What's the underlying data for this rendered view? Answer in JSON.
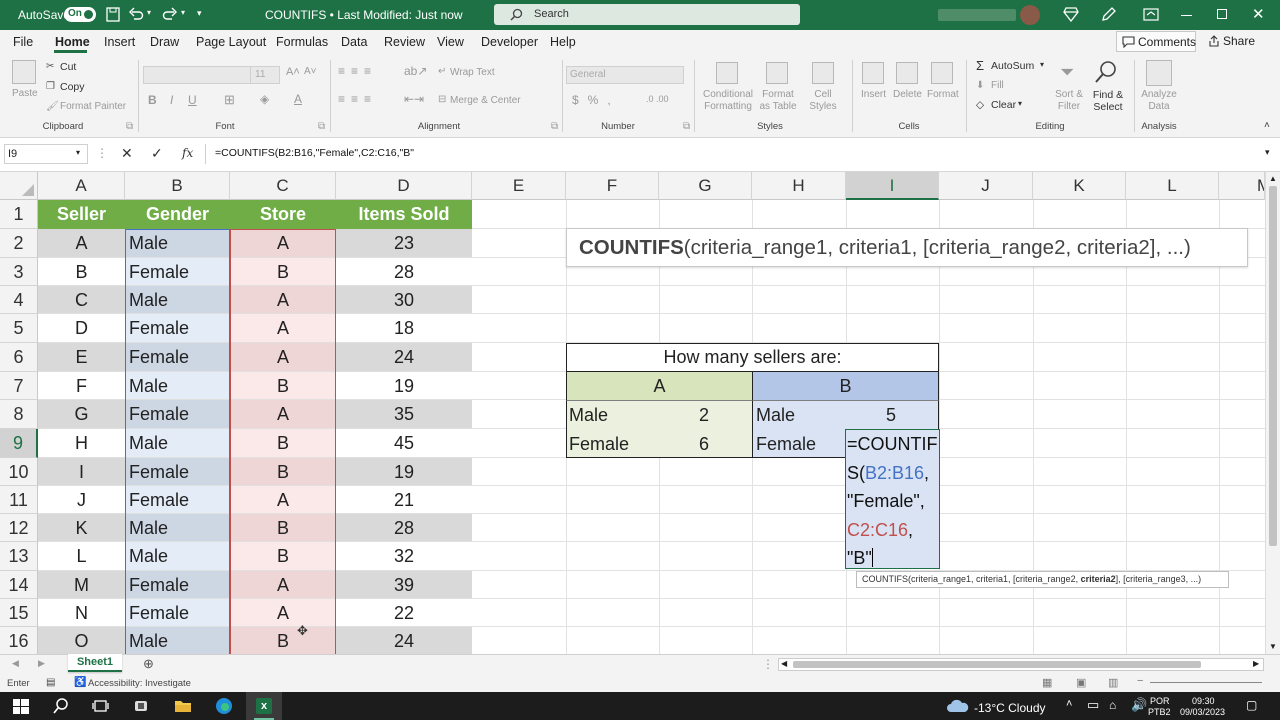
{
  "titlebar": {
    "autosave_label": "AutoSave",
    "autosave_state": "On",
    "doc_title": "COUNTIFS • Last Modified: Just now",
    "search_placeholder": "Search"
  },
  "menu": [
    "File",
    "Home",
    "Insert",
    "Draw",
    "Page Layout",
    "Formulas",
    "Data",
    "Review",
    "View",
    "Developer",
    "Help"
  ],
  "active_menu": "Home",
  "actions": {
    "comments": "Comments",
    "share": "Share"
  },
  "ribbon": {
    "clipboard": {
      "paste": "Paste",
      "cut": "Cut",
      "copy": "Copy",
      "format_painter": "Format Painter",
      "group": "Clipboard"
    },
    "font": {
      "font_name": "",
      "font_size": "11",
      "group": "Font"
    },
    "alignment": {
      "wrap_text": "Wrap Text",
      "merge": "Merge & Center",
      "group": "Alignment"
    },
    "number": {
      "format": "General",
      "group": "Number"
    },
    "styles": {
      "conditional": "Conditional Formatting",
      "format_table": "Format as Table",
      "cell_styles": "Cell Styles",
      "group": "Styles"
    },
    "cells": {
      "insert": "Insert",
      "delete": "Delete",
      "format": "Format",
      "group": "Cells"
    },
    "editing": {
      "autosum": "AutoSum",
      "fill": "Fill",
      "clear": "Clear",
      "sort": "Sort & Filter",
      "find": "Find & Select",
      "group": "Editing"
    },
    "analysis": {
      "analyze": "Analyze Data",
      "group": "Analysis"
    }
  },
  "formula_bar": {
    "name_box": "I9",
    "formula": "=COUNTIFS(B2:B16,\"Female\",C2:C16,\"B\""
  },
  "columns": [
    "A",
    "B",
    "C",
    "D",
    "E",
    "F",
    "G",
    "H",
    "I",
    "J",
    "K",
    "L",
    "M"
  ],
  "headers": {
    "seller": "Seller",
    "gender": "Gender",
    "store": "Store",
    "items": "Items Sold"
  },
  "rows": [
    {
      "n": "2",
      "seller": "A",
      "gender": "Male",
      "store": "A",
      "items": "23"
    },
    {
      "n": "3",
      "seller": "B",
      "gender": "Female",
      "store": "B",
      "items": "28"
    },
    {
      "n": "4",
      "seller": "C",
      "gender": "Male",
      "store": "A",
      "items": "30"
    },
    {
      "n": "5",
      "seller": "D",
      "gender": "Female",
      "store": "A",
      "items": "18"
    },
    {
      "n": "6",
      "seller": "E",
      "gender": "Female",
      "store": "A",
      "items": "24"
    },
    {
      "n": "7",
      "seller": "F",
      "gender": "Male",
      "store": "B",
      "items": "19"
    },
    {
      "n": "8",
      "seller": "G",
      "gender": "Female",
      "store": "A",
      "items": "35"
    },
    {
      "n": "9",
      "seller": "H",
      "gender": "Male",
      "store": "B",
      "items": "45"
    },
    {
      "n": "10",
      "seller": "I",
      "gender": "Female",
      "store": "B",
      "items": "19"
    },
    {
      "n": "11",
      "seller": "J",
      "gender": "Female",
      "store": "A",
      "items": "21"
    },
    {
      "n": "12",
      "seller": "K",
      "gender": "Male",
      "store": "B",
      "items": "28"
    },
    {
      "n": "13",
      "seller": "L",
      "gender": "Male",
      "store": "B",
      "items": "32"
    },
    {
      "n": "14",
      "seller": "M",
      "gender": "Female",
      "store": "A",
      "items": "39"
    },
    {
      "n": "15",
      "seller": "N",
      "gender": "Female",
      "store": "A",
      "items": "22"
    },
    {
      "n": "16",
      "seller": "O",
      "gender": "Male",
      "store": "B",
      "items": "24"
    }
  ],
  "syntax_box": {
    "fn": "COUNTIFS",
    "args": "(criteria_range1, criteria1, [criteria_range2, criteria2], ...)"
  },
  "summary": {
    "title": "How many sellers are:",
    "store_a": "A",
    "store_b": "B",
    "male": "Male",
    "female": "Female",
    "a_male": "2",
    "a_female": "6",
    "b_male": "5"
  },
  "editing_cell": {
    "line1": "=COUNTIF",
    "line2a": "S(",
    "line2b": "B2:B16",
    "line2c": ",",
    "line3": "\"Female\",",
    "line4a": "C2:C16",
    "line4b": ",",
    "line5": "\"B\""
  },
  "tooltip": {
    "pre": "COUNTIFS(criteria_range1, criteria1, [criteria_range2, ",
    "bold": "criteria2",
    "post": "], [criteria_range3, ...)"
  },
  "sheet_tab": "Sheet1",
  "status": {
    "mode": "Enter",
    "accessibility": "Accessibility: Investigate"
  },
  "taskbar": {
    "weather": "-13°C  Cloudy",
    "lang1": "POR",
    "lang2": "PTB2",
    "time": "09:30",
    "date": "09/03/2023"
  },
  "colors": {
    "excel_green": "#1e7145",
    "header_green": "#70ad47",
    "range_blue": "#4472c4",
    "range_red": "#c0504d"
  }
}
